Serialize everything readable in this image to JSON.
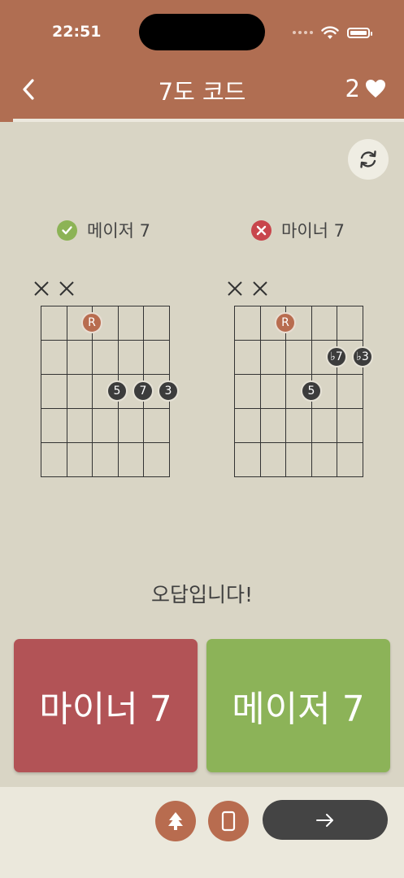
{
  "status_bar": {
    "time": "22:51"
  },
  "header": {
    "title": "7도 코드",
    "hearts": "2"
  },
  "quiz": {
    "progress_fraction": 0.03
  },
  "options": [
    {
      "label": "메이저 7",
      "status": "correct",
      "color": "#8cb356"
    },
    {
      "label": "마이너 7",
      "status": "wrong",
      "color": "#c8464c"
    }
  ],
  "diagrams": [
    {
      "muted_strings": 2,
      "root_label": "R",
      "notes": [
        "5",
        "7",
        "3"
      ]
    },
    {
      "muted_strings": 2,
      "root_label": "R",
      "notes": [
        "♭7",
        "♭3",
        "5"
      ]
    }
  ],
  "result_text": "오답입니다!",
  "answers": [
    {
      "label": "마이너 7",
      "color": "#b25356"
    },
    {
      "label": "메이저 7",
      "color": "#8cb358"
    }
  ],
  "colors": {
    "accent": "#b06e52",
    "background": "#d9d5c5",
    "dark": "#444444"
  }
}
